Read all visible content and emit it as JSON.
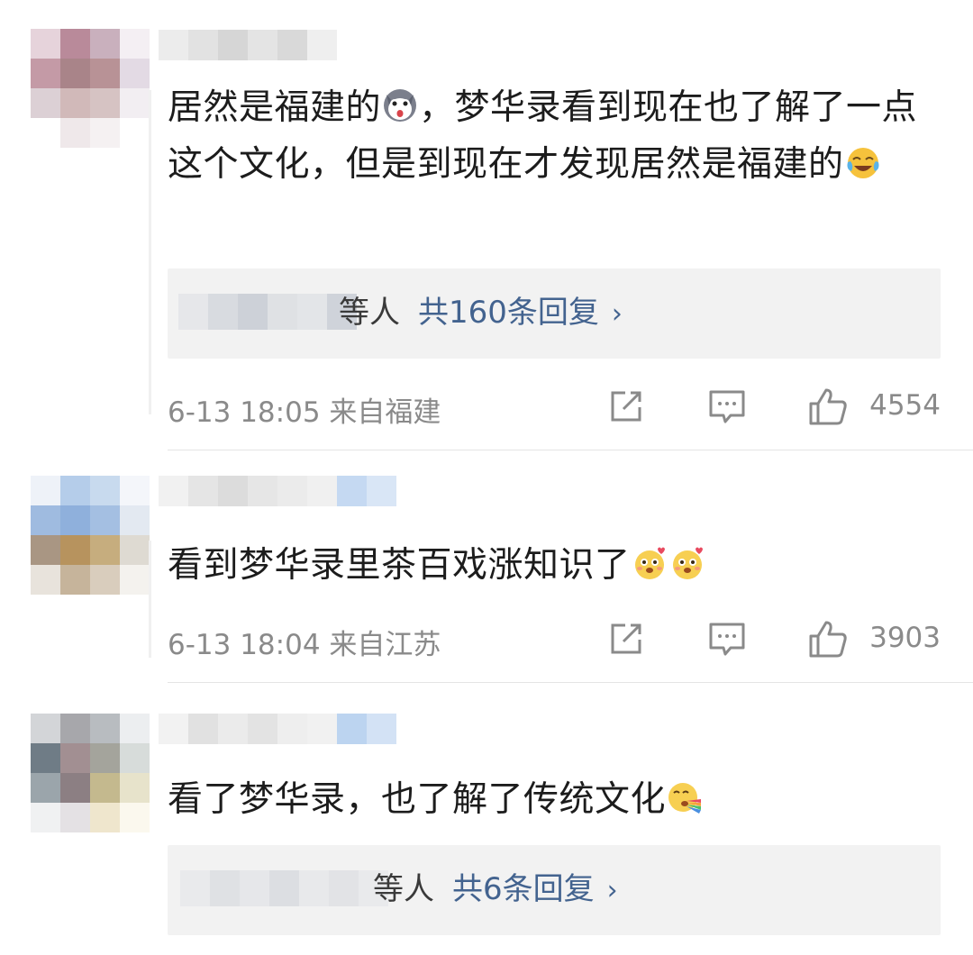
{
  "colors": {
    "link": "#43638f",
    "meta_text": "#8a8a8a",
    "body_text": "#1c1c1c",
    "reply_bg": "#f2f2f2"
  },
  "comments": [
    {
      "text_part1": "居然是福建的",
      "emoji1": "husky-surprised-emoji",
      "text_part2": "，梦华录看到现在也了解了一点这个文化，但是到现在才发现居然是福建的",
      "emoji2": "laugh-cry-emoji",
      "reply_who": "等人",
      "reply_count": "共160条回复",
      "reply_chevron": "›",
      "time": "6-13 18:05",
      "location": "来自福建",
      "likes": "4554"
    },
    {
      "text": "看到梦华录里茶百戏涨知识了",
      "emoji1": "blush-hearts-emoji",
      "emoji2": "blush-hearts-emoji",
      "time": "6-13 18:04",
      "location": "来自江苏",
      "likes": "3903"
    },
    {
      "text": "看了梦华录，也了解了传统文化",
      "emoji1": "rainbow-vomit-emoji",
      "reply_who": "等人",
      "reply_count": "共6条回复",
      "reply_chevron": "›"
    }
  ],
  "icons": {
    "share": "share-icon",
    "comment": "comment-icon",
    "like": "thumbs-up-icon"
  }
}
